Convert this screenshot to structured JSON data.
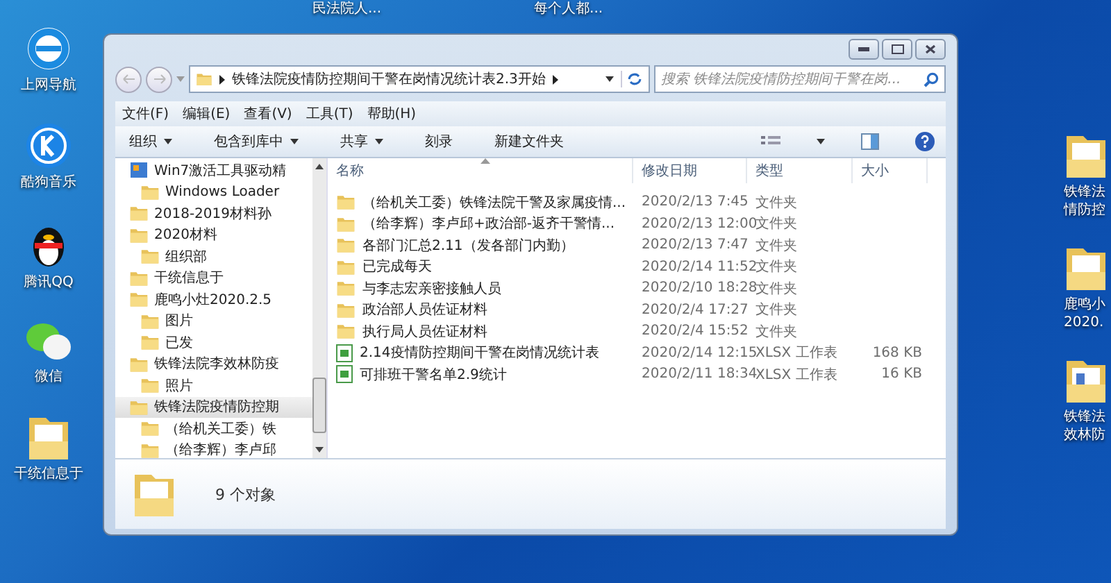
{
  "desktop_captions_top": [
    "民法院人...",
    "每个人都..."
  ],
  "desktop_icons_left": [
    {
      "label": "上网导航",
      "kind": "browser"
    },
    {
      "label": "酷狗音乐",
      "kind": "music"
    },
    {
      "label": "腾讯QQ",
      "kind": "qq"
    },
    {
      "label": "微信",
      "kind": "chat"
    },
    {
      "label": "干统信息于",
      "kind": "folder"
    }
  ],
  "desktop_icons_right": [
    {
      "label": "铁锋法情防控",
      "kind": "folder"
    },
    {
      "label": "鹿鸣小2020.",
      "kind": "folder"
    },
    {
      "label": "铁锋法效林防",
      "kind": "folder-doc"
    }
  ],
  "window": {
    "address": [
      "铁锋法院疫情防控期间干警在岗情况统计表2.3开始"
    ],
    "search": {
      "placeholder": "搜索 铁锋法院疫情防控期间干警在岗..."
    },
    "menu": [
      "文件(F)",
      "编辑(E)",
      "查看(V)",
      "工具(T)",
      "帮助(H)"
    ],
    "toolbar": [
      {
        "label": "组织",
        "dropdown": true
      },
      {
        "label": "包含到库中",
        "dropdown": true
      },
      {
        "label": "共享",
        "dropdown": true
      },
      {
        "label": "刻录",
        "dropdown": false
      },
      {
        "label": "新建文件夹",
        "dropdown": false
      }
    ],
    "nav_tree": [
      {
        "label": "Win7激活工具驱动精",
        "kind": "app",
        "selected": false,
        "children": [
          {
            "label": "Windows Loader",
            "kind": "folder",
            "selected": false
          }
        ]
      },
      {
        "label": "2018-2019材料孙",
        "kind": "folder",
        "selected": false
      },
      {
        "label": "2020材料",
        "kind": "folder",
        "selected": false,
        "children": [
          {
            "label": "组织部",
            "kind": "folder",
            "selected": false
          }
        ]
      },
      {
        "label": "干统信息于",
        "kind": "folder",
        "selected": false
      },
      {
        "label": "鹿鸣小灶2020.2.5",
        "kind": "folder",
        "selected": false,
        "children": [
          {
            "label": "图片",
            "kind": "folder",
            "selected": false
          },
          {
            "label": "已发",
            "kind": "folder",
            "selected": false
          }
        ]
      },
      {
        "label": "铁锋法院李效林防疫",
        "kind": "folder",
        "selected": false,
        "children": [
          {
            "label": "照片",
            "kind": "folder",
            "selected": false
          }
        ]
      },
      {
        "label": "铁锋法院疫情防控期",
        "kind": "folder",
        "selected": true,
        "children": [
          {
            "label": "（给机关工委）铁",
            "kind": "folder",
            "selected": false
          },
          {
            "label": "（给李辉）李卢邱",
            "kind": "folder",
            "selected": false
          }
        ]
      }
    ],
    "columns": [
      "名称",
      "修改日期",
      "类型",
      "大小"
    ],
    "files": [
      {
        "name": "（给机关工委）铁锋法院干警及家属疫情...",
        "date": "2020/2/13 7:45",
        "type": "文件夹",
        "kind": "folder"
      },
      {
        "name": "（给李辉）李卢邱+政治部-返齐干警情...",
        "date": "2020/2/13 12:00",
        "type": "文件夹",
        "kind": "folder"
      },
      {
        "name": "各部门汇总2.11（发各部门内勤）",
        "date": "2020/2/13 7:47",
        "type": "文件夹",
        "kind": "folder"
      },
      {
        "name": "已完成每天",
        "date": "2020/2/14 11:52",
        "type": "文件夹",
        "kind": "folder"
      },
      {
        "name": "与李志宏亲密接触人员",
        "date": "2020/2/10 18:28",
        "type": "文件夹",
        "kind": "folder"
      },
      {
        "name": "政治部人员佐证材料",
        "date": "2020/2/4 17:27",
        "type": "文件夹",
        "kind": "folder"
      },
      {
        "name": "执行局人员佐证材料",
        "date": "2020/2/4 15:52",
        "type": "文件夹",
        "kind": "folder"
      },
      {
        "name": "2.14疫情防控期间干警在岗情况统计表",
        "date": "2020/2/14 12:15",
        "type": "XLSX 工作表",
        "size": "168 KB",
        "kind": "xlsx"
      },
      {
        "name": "可排班干警名单2.9统计",
        "date": "2020/2/11 18:34",
        "type": "XLSX 工作表",
        "size": "16 KB",
        "kind": "xlsx"
      }
    ],
    "status": "9 个对象"
  }
}
